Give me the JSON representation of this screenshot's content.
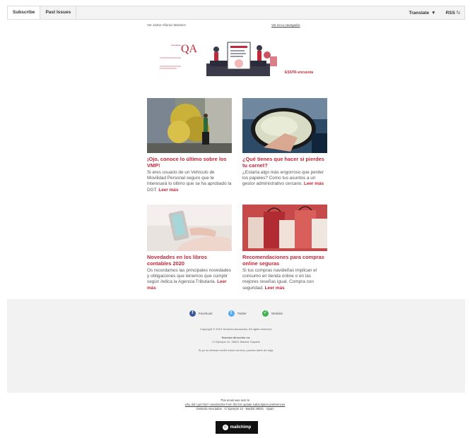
{
  "toolbar": {
    "subscribe": "Subscribe",
    "past_issues": "Past Issues",
    "translate": "Translate",
    "rss": "RSS"
  },
  "prehead": {
    "left": "Ver Jaime-Alfonso Martinez",
    "right": "Ver en tu navegador"
  },
  "banner": {
    "logo_mark": "QA",
    "logo_text": "Asociados",
    "link": "ESSTR-encuesta"
  },
  "articles": [
    {
      "title": "¡Ojo, conoce lo último sobre los VMP!",
      "body": "Si eres usuario de un Vehículo de Movilidad Personal seguro que te interesará lo último que se ha aprobado la DGT.",
      "more": "Leer más"
    },
    {
      "title": "¿Qué tienes que hacer si pierdes tu carnet?",
      "body": "¿Estaría algo más engorroso que perder los papeles? Como tus asuntos a un gestor administrativo cercano.",
      "more": "Leer más"
    },
    {
      "title": "Novedades en los libros contables 2020",
      "body": "Os recordamos las principales novedades y obligaciones que tenemos que cumplir según indica la Agencia Tributaria.",
      "more": "Leer más"
    },
    {
      "title": "Recomendaciones para compras online seguras",
      "body": "Si tus compras navideñas implican el consumo en tienda online o en las mejores reseñas igual. Compra con seguridad.",
      "more": "Leer más"
    }
  ],
  "social": [
    "Facebook",
    "Twitter",
    "Website"
  ],
  "footer": {
    "copyright": "Copyright © 2019 Gestoría Asociados, All rights reserved.",
    "address_label": "Nuestra dirección es:",
    "address": "C/ Ejemplo 12, 28001 Madrid, España",
    "unsubscribe": "Si ya no deseas recibir estos correos, puedes darte de baja."
  },
  "bottom": {
    "line1": "This email was sent to",
    "line2": "why did I get this?   unsubscribe from this list   update subscription preferences",
    "line3": "Gestoría Asociados · C/ Ejemplo 12 · Madrid 28001 · Spain"
  },
  "brand": {
    "name": "mailchimp"
  },
  "colors": {
    "accent": "#c1283a",
    "facebook": "#3b5998",
    "twitter": "#55acee",
    "website": "#3fb34f"
  }
}
